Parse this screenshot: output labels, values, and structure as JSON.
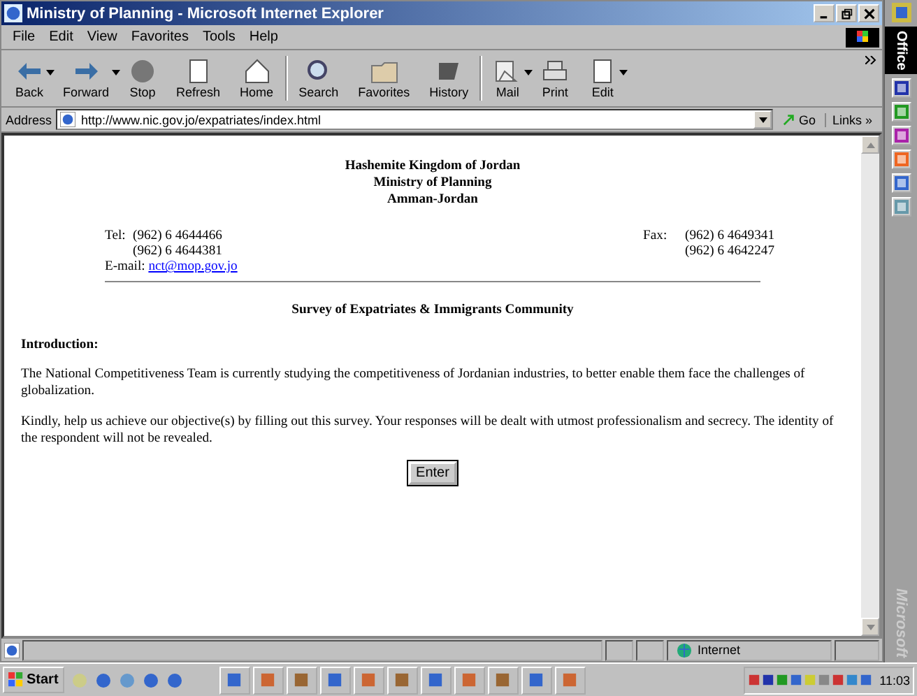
{
  "window": {
    "title": "Ministry of Planning - Microsoft Internet Explorer"
  },
  "menu": [
    "File",
    "Edit",
    "View",
    "Favorites",
    "Tools",
    "Help"
  ],
  "toolbar": [
    {
      "label": "Back",
      "kind": "back",
      "dropdown": true
    },
    {
      "label": "Forward",
      "kind": "forward",
      "dropdown": true
    },
    {
      "label": "Stop",
      "kind": "stop",
      "dropdown": false
    },
    {
      "label": "Refresh",
      "kind": "refresh",
      "dropdown": false
    },
    {
      "label": "Home",
      "kind": "home",
      "dropdown": false
    },
    {
      "label": "Search",
      "kind": "search",
      "dropdown": false
    },
    {
      "label": "Favorites",
      "kind": "favorites",
      "dropdown": false
    },
    {
      "label": "History",
      "kind": "history",
      "dropdown": false
    },
    {
      "label": "Mail",
      "kind": "mail",
      "dropdown": true
    },
    {
      "label": "Print",
      "kind": "print",
      "dropdown": false
    },
    {
      "label": "Edit",
      "kind": "edit",
      "dropdown": true
    }
  ],
  "address": {
    "label": "Address",
    "url": "http://www.nic.gov.jo/expatriates/index.html",
    "go": "Go",
    "links": "Links »"
  },
  "page": {
    "heading": [
      "Hashemite Kingdom of Jordan",
      "Ministry of Planning",
      "Amman-Jordan"
    ],
    "tel_label": "Tel:",
    "tel": [
      "(962) 6 4644466",
      "(962) 6 4644381"
    ],
    "email_label": "E-mail:",
    "email": "nct@mop.gov.jo",
    "fax_label": "Fax:",
    "fax": [
      "(962) 6 4649341",
      "(962) 6 4642247"
    ],
    "survey_title": "Survey of Expatriates & Immigrants Community",
    "intro_heading": "Introduction:",
    "paragraphs": [
      "The National Competitiveness Team is currently studying the competitiveness of Jordanian industries, to better enable them face the challenges of globalization.",
      "Kindly, help us achieve our objective(s) by filling out this survey. Your responses will be dealt with utmost professionalism and secrecy. The identity of the respondent will not be revealed."
    ],
    "enter_button": "Enter"
  },
  "status_bar": {
    "zone": "Internet"
  },
  "office_bar": {
    "title": "Office",
    "brand": "Microsoft"
  },
  "taskbar": {
    "start": "Start",
    "clock": "11:03"
  }
}
